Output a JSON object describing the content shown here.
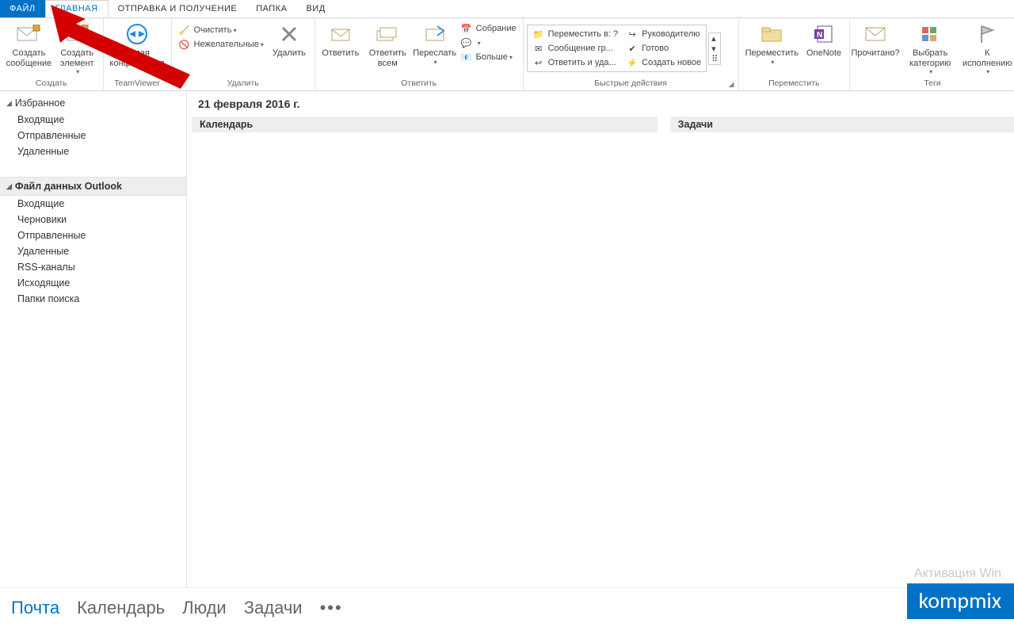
{
  "tabs": {
    "file": "ФАЙЛ",
    "home": "ГЛАВНАЯ",
    "sendrecv": "ОТПРАВКА И ПОЛУЧЕНИЕ",
    "folder": "ПАПКА",
    "view": "ВИД"
  },
  "ribbon": {
    "create": {
      "label": "Создать",
      "newmsg": "Создать сообщение",
      "newitem": "Создать элемент"
    },
    "teamviewer": {
      "label": "TeamViewer",
      "btn": "Новая конференция"
    },
    "delete": {
      "label": "Удалить",
      "clean": "Очистить",
      "junk": "Нежелательные",
      "del": "Удалить"
    },
    "reply": {
      "label": "Ответить",
      "reply": "Ответить",
      "replyall": "Ответить всем",
      "forward": "Переслать",
      "meeting": "Собрание",
      "im": "",
      "more": "Больше"
    },
    "quick": {
      "label": "Быстрые действия",
      "moveToQ": "Переместить в: ?",
      "toManager": "Руководителю",
      "teamMsg": "Сообщение гр...",
      "done": "Готово",
      "replyDel": "Ответить и уда...",
      "createNew": "Создать новое"
    },
    "move": {
      "label": "Переместить",
      "move": "Переместить",
      "onenote": "OneNote"
    },
    "tags": {
      "label": "Теги",
      "read": "Прочитано?",
      "cat": "Выбрать категорию",
      "flag": "К исполнению"
    }
  },
  "nav": {
    "fav": "Избранное",
    "favItems": [
      "Входящие",
      "Отправленные",
      "Удаленные"
    ],
    "data": "Файл данных Outlook",
    "dataItems": [
      "Входящие",
      "Черновики",
      "Отправленные",
      "Удаленные",
      "RSS-каналы",
      "Исходящие",
      "Папки поиска"
    ]
  },
  "content": {
    "date": "21 февраля 2016 г.",
    "calendar": "Календарь",
    "tasks": "Задачи"
  },
  "bottom": {
    "mail": "Почта",
    "calendar": "Календарь",
    "people": "Люди",
    "tasks": "Задачи"
  },
  "watermark": "Активация Win",
  "brand": "kompmix"
}
